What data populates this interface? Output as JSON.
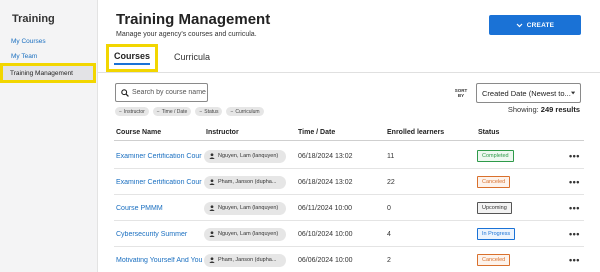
{
  "sidebar": {
    "title": "Training",
    "items": [
      {
        "label": "My Courses"
      },
      {
        "label": "My Team"
      },
      {
        "label": "Training Management"
      }
    ]
  },
  "header": {
    "title": "Training Management",
    "subtitle": "Manage your agency's courses and curricula.",
    "create_label": "CREATE"
  },
  "tabs": [
    {
      "label": "Courses",
      "active": true
    },
    {
      "label": "Curricula",
      "active": false
    }
  ],
  "search": {
    "placeholder": "Search by course name",
    "value": ""
  },
  "filters": [
    "Instructor",
    "Time / Date",
    "Status",
    "Curriculum"
  ],
  "sort": {
    "label": "SORT BY",
    "value": "Created Date (Newest to..."
  },
  "showing": {
    "prefix": "Showing:",
    "count": "249 results"
  },
  "table": {
    "columns": [
      "Course Name",
      "Instructor",
      "Time / Date",
      "Enrolled learners",
      "Status"
    ],
    "rows": [
      {
        "course": "Examiner Certification Cour",
        "instructor": "Nguyen, Lam (lanquyen)",
        "date": "06/18/2024 13:02",
        "enrolled": "11",
        "status": "Completed"
      },
      {
        "course": "Examiner Certification Cour",
        "instructor": "Pham, Janson (dupha...",
        "date": "06/18/2024 13:02",
        "enrolled": "22",
        "status": "Canceled"
      },
      {
        "course": "Course PMMM",
        "instructor": "Nguyen, Lam (lanquyen)",
        "date": "06/11/2024 10:00",
        "enrolled": "0",
        "status": "Upcoming"
      },
      {
        "course": "Cybersecurity Summer",
        "instructor": "Nguyen, Lam (lanquyen)",
        "date": "06/10/2024 10:00",
        "enrolled": "4",
        "status": "In Progress"
      },
      {
        "course": "Motivating Yourself And You",
        "instructor": "Pham, Janson (dupha...",
        "date": "06/06/2024 10:00",
        "enrolled": "2",
        "status": "Canceled"
      }
    ]
  },
  "status_colors": {
    "Completed": {
      "border": "#2e9a4a",
      "text": "#2e9a4a",
      "bg": "#eef8f0"
    },
    "Canceled": {
      "border": "#d9702c",
      "text": "#d9702c",
      "bg": "#fdf3ec"
    },
    "Upcoming": {
      "border": "#555555",
      "text": "#333333",
      "bg": "#f2f2f2"
    },
    "In Progress": {
      "border": "#1a72d6",
      "text": "#1a72d6",
      "bg": "#edf4fd"
    }
  },
  "icons": {
    "search": "search-icon",
    "user": "user-icon",
    "more": "more-horizontal-icon",
    "remove": "remove-icon",
    "chevron": "chevron-down-icon"
  }
}
